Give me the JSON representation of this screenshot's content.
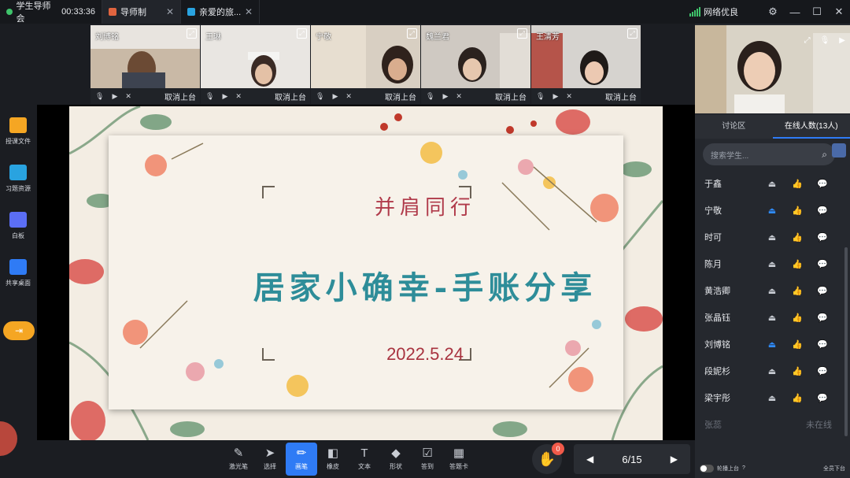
{
  "tabs": [
    {
      "label": "学生导师会",
      "time": "00:33:36",
      "color": "#3fc46b"
    },
    {
      "label": "导师制",
      "color": "#e0643f"
    },
    {
      "label": "亲爱的旅...",
      "color": "#29a3e0"
    }
  ],
  "network": {
    "label": "网络优良"
  },
  "video_tiles": [
    {
      "name": "刘博铭",
      "remove": "取消上台"
    },
    {
      "name": "王琳",
      "remove": "取消上台"
    },
    {
      "name": "宁敬",
      "remove": "取消上台"
    },
    {
      "name": "魏兰君",
      "remove": "取消上台"
    },
    {
      "name": "王清芳",
      "remove": "取消上台"
    }
  ],
  "leftbar": [
    {
      "label": "授课文件",
      "icon": "folder-icon",
      "color": "#f5a623"
    },
    {
      "label": "习题资源",
      "icon": "exercise-icon",
      "color": "#29a3e0"
    },
    {
      "label": "白板",
      "icon": "whiteboard-icon",
      "color": "#5b6ef5"
    },
    {
      "label": "共享桌面",
      "icon": "share-screen-icon",
      "color": "#2f7bf5"
    }
  ],
  "slide": {
    "subtitle": "并肩同行",
    "title": "居家小确幸-手账分享",
    "date": "2022.5.24"
  },
  "tools": [
    {
      "label": "激光笔",
      "glyph": "✎"
    },
    {
      "label": "选择",
      "glyph": "➤"
    },
    {
      "label": "画笔",
      "glyph": "✏"
    },
    {
      "label": "橡皮",
      "glyph": "◧"
    },
    {
      "label": "文本",
      "glyph": "T"
    },
    {
      "label": "形状",
      "glyph": "◆"
    },
    {
      "label": "答到",
      "glyph": "☑"
    },
    {
      "label": "答题卡",
      "glyph": "▦"
    }
  ],
  "hand_count": "0",
  "pager": {
    "current": "6/15"
  },
  "panel": {
    "tab_discuss": "讨论区",
    "tab_online": "在线人数(13人)",
    "search_placeholder": "搜索学生..."
  },
  "participants": [
    {
      "name": "于鑫",
      "on": false
    },
    {
      "name": "宁敬",
      "on": true
    },
    {
      "name": "时可",
      "on": false
    },
    {
      "name": "陈月",
      "on": false
    },
    {
      "name": "黄浩卿",
      "on": false
    },
    {
      "name": "张晶钰",
      "on": false
    },
    {
      "name": "刘博铭",
      "on": true
    },
    {
      "name": "段妮杉",
      "on": false
    },
    {
      "name": "梁宇彤",
      "on": false
    }
  ],
  "offline": {
    "name": "张蕊",
    "status": "未在线"
  },
  "footer": {
    "toggle_label": "轮播上台",
    "mute_label": "全员下台"
  }
}
